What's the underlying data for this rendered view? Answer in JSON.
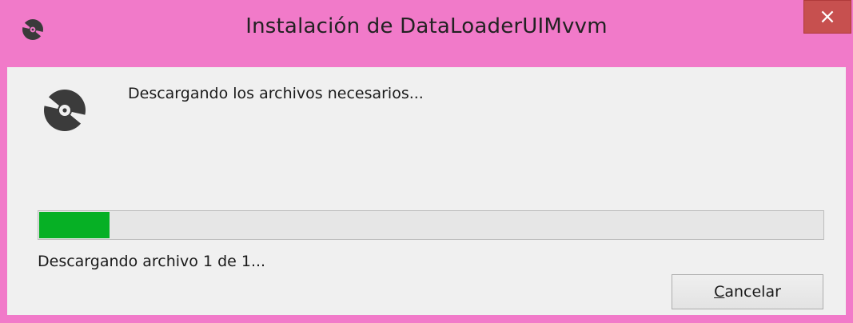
{
  "window": {
    "title": "Instalación de DataLoaderUIMvvm",
    "close_glyph": "×"
  },
  "main": {
    "status": "Descargando los archivos necesarios...",
    "progress_percent": 9,
    "progress_status": "Descargando archivo 1 de 1..."
  },
  "buttons": {
    "cancel_accel": "C",
    "cancel_rest": "ancelar"
  },
  "icons": {
    "title": "disc-install-icon",
    "main": "disc-install-icon",
    "close": "close-icon"
  },
  "colors": {
    "titlebar": "#f17ac9",
    "close_button": "#c7504f",
    "client": "#f0f0f0",
    "progress_fill": "#06b025"
  }
}
